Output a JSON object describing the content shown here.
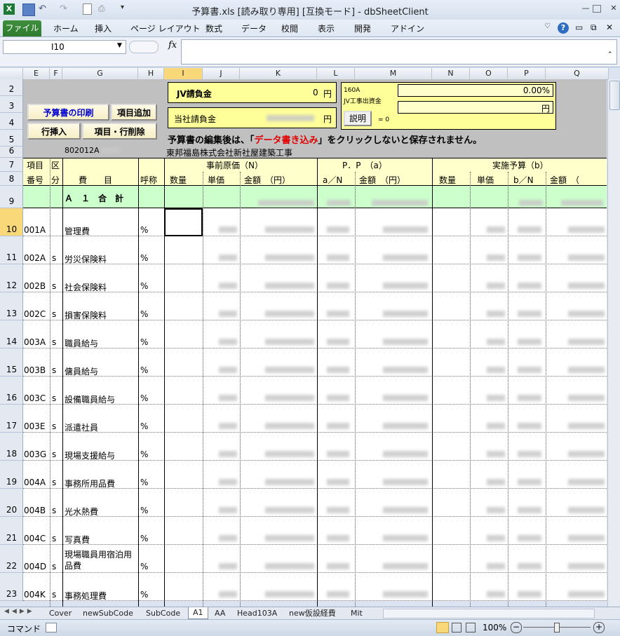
{
  "window": {
    "title": "予算書.xls  [読み取り専用]  [互換モード] - dbSheetClient"
  },
  "ribbon": {
    "file_tab": "ファイル",
    "tabs": [
      "ホーム",
      "挿入",
      "ページ レイアウト",
      "数式",
      "データ",
      "校閲",
      "表示",
      "開発",
      "アドイン"
    ]
  },
  "formula_bar": {
    "name_box": "I10",
    "fx_label": "fx",
    "content": ""
  },
  "columns": [
    "E",
    "F",
    "G",
    "H",
    "I",
    "J",
    "K",
    "L",
    "M",
    "N",
    "O",
    "P",
    "Q"
  ],
  "sheet": {
    "buttons": {
      "print": "予算書の印刷",
      "add_item": "項目追加",
      "insert_row": "行挿入",
      "delete": "項目・行削除"
    },
    "jv_label": "JV請負金",
    "jv_value": "0",
    "yen": "円",
    "company_label": "当社請負金",
    "info_box": {
      "code": "160A",
      "label": "JV工事出資金",
      "percent": "0.00%",
      "yen": "円",
      "explain_button": "説明",
      "eq": "= 0"
    },
    "notice": {
      "before": "予算書の編集後は、「",
      "highlight": "データ書き込み",
      "after": "」をクリックしないと保存されません。"
    },
    "code_label": "802012A",
    "project_name": "東邦福島株式会社新社屋建築工事",
    "headers": {
      "item": "項目",
      "kubun": "区",
      "number": "番号",
      "bun": "分",
      "himoku": "費　　目",
      "kosho": "呼称",
      "jizen": "事前原価（N）",
      "pp": "P．P　（a）",
      "jisshi": "実施予算（b）",
      "qty": "数量",
      "unit_price": "単価",
      "amount": "金額　（円）",
      "an": "a／N",
      "bn": "b／N",
      "amount2": "金額　（円）",
      "amount3": "金額　（"
    },
    "total_label": "Ａ　１　合　計",
    "rows": [
      {
        "row": "10",
        "code": "001A",
        "kubun": "",
        "name": "管理費",
        "unit": "%"
      },
      {
        "row": "11",
        "code": "002A",
        "kubun": "s",
        "name": "労災保険料",
        "unit": "%"
      },
      {
        "row": "12",
        "code": "002B",
        "kubun": "s",
        "name": "社会保険料",
        "unit": "%"
      },
      {
        "row": "13",
        "code": "002C",
        "kubun": "s",
        "name": "損害保険料",
        "unit": "%"
      },
      {
        "row": "14",
        "code": "003A",
        "kubun": "s",
        "name": "職員給与",
        "unit": "%"
      },
      {
        "row": "15",
        "code": "003B",
        "kubun": "s",
        "name": "傭員給与",
        "unit": "%"
      },
      {
        "row": "16",
        "code": "003C",
        "kubun": "s",
        "name": "設備職員給与",
        "unit": "%"
      },
      {
        "row": "17",
        "code": "003E",
        "kubun": "s",
        "name": "派遣社員",
        "unit": "%"
      },
      {
        "row": "18",
        "code": "003G",
        "kubun": "s",
        "name": "現場支援給与",
        "unit": "%"
      },
      {
        "row": "19",
        "code": "004A",
        "kubun": "s",
        "name": "事務所用品費",
        "unit": "%"
      },
      {
        "row": "20",
        "code": "004B",
        "kubun": "s",
        "name": "光水熱費",
        "unit": "%"
      },
      {
        "row": "21",
        "code": "004C",
        "kubun": "s",
        "name": "写真費",
        "unit": "%"
      },
      {
        "row": "22",
        "code": "004D",
        "kubun": "s",
        "name": "現場職員用宿泊用品費",
        "unit": "%"
      },
      {
        "row": "23",
        "code": "004K",
        "kubun": "s",
        "name": "事務処理費",
        "unit": "%"
      }
    ]
  },
  "sheet_tabs": [
    "Cover",
    "newSubCode",
    "SubCode",
    "A1",
    "AA",
    "Head103A",
    "new仮設経費",
    "Mit"
  ],
  "active_tab": "A1",
  "status": {
    "mode": "コマンド",
    "zoom": "100%"
  }
}
